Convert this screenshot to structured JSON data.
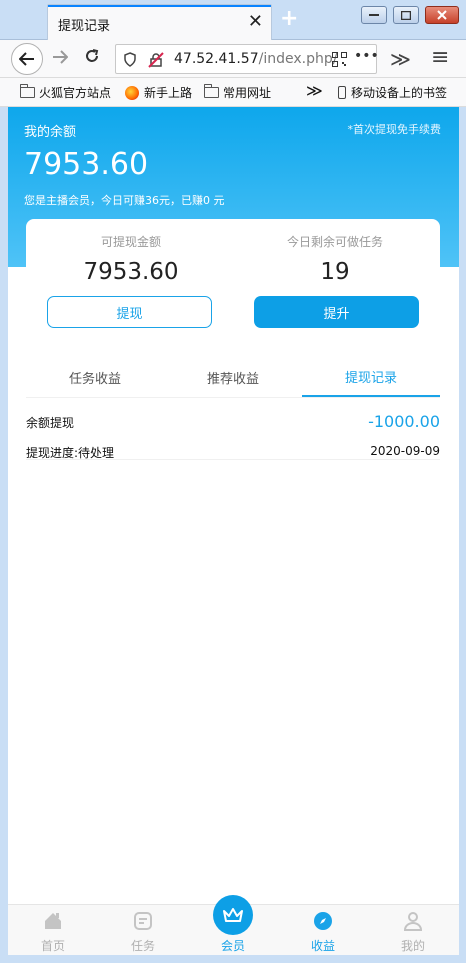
{
  "browser": {
    "tab_title": "提现记录",
    "tab_close": "✕",
    "new_tab": "+",
    "url_host": "47.52.41.57",
    "url_path": "/index.php/",
    "more": "•••",
    "overflow": "≫",
    "menu": "≡"
  },
  "bookmarks": [
    {
      "label": "火狐官方站点",
      "icon": "folder-icon"
    },
    {
      "label": "新手上路",
      "icon": "firefox-icon"
    },
    {
      "label": "常用网址",
      "icon": "folder-icon"
    },
    {
      "label": "移动设备上的书签",
      "icon": "mobile-icon"
    }
  ],
  "bookmarks_overflow": "≫",
  "hero": {
    "label": "我的余额",
    "note": "*首次提现免手续费",
    "balance": "7953.60",
    "subtext": "您是主播会员，今日可赚36元，已赚0 元"
  },
  "stats": {
    "withdrawable_label": "可提现金额",
    "withdrawable_value": "7953.60",
    "tasks_label": "今日剩余可做任务",
    "tasks_value": "19",
    "withdraw_button": "提现",
    "upgrade_button": "提升"
  },
  "tabs": [
    {
      "label": "任务收益",
      "active": false
    },
    {
      "label": "推荐收益",
      "active": false
    },
    {
      "label": "提现记录",
      "active": true
    }
  ],
  "records": [
    {
      "title": "余额提现",
      "amount": "-1000.00",
      "status": "提现进度:待处理",
      "date": "2020-09-09"
    }
  ],
  "bottom_nav": [
    {
      "label": "首页",
      "icon": "home-icon",
      "active": false
    },
    {
      "label": "任务",
      "icon": "task-icon",
      "active": false
    },
    {
      "label": "会员",
      "icon": "crown-icon",
      "active": true
    },
    {
      "label": "收益",
      "icon": "compass-icon",
      "active": true
    },
    {
      "label": "我的",
      "icon": "user-icon",
      "active": false
    }
  ],
  "colors": {
    "accent": "#1aa3e8",
    "hero_top": "#0ea7ec",
    "hero_bottom": "#4fc3f7",
    "inactive_nav": "#b0b0b0"
  }
}
